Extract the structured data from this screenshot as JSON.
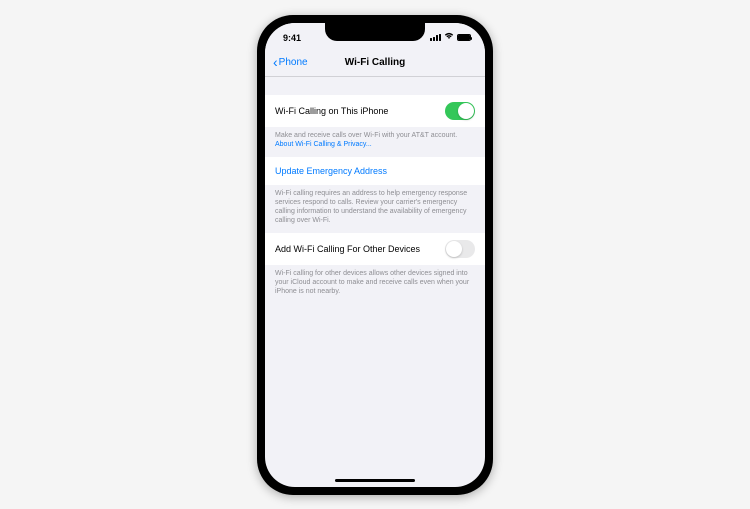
{
  "status": {
    "time": "9:41"
  },
  "nav": {
    "back": "Phone",
    "title": "Wi-Fi Calling"
  },
  "section1": {
    "toggle_label": "Wi-Fi Calling on This iPhone",
    "toggle_on": true,
    "footer_text": "Make and receive calls over Wi-Fi with your AT&T account.",
    "footer_link": "About Wi-Fi Calling & Privacy..."
  },
  "section2": {
    "link_label": "Update Emergency Address",
    "footer_text": "Wi-Fi calling requires an address to help emergency response services respond to calls. Review your carrier's emergency calling information to understand the availability of emergency calling over Wi-Fi."
  },
  "section3": {
    "toggle_label": "Add Wi-Fi Calling For Other Devices",
    "toggle_on": false,
    "footer_text": "Wi-Fi calling for other devices allows other devices signed into your iCloud account to make and receive calls even when your iPhone is not nearby."
  }
}
